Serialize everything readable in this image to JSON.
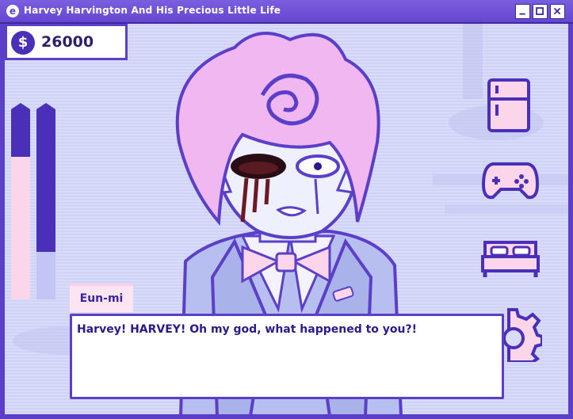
{
  "window": {
    "title": "Harvey Harvington And His Precious Little Life",
    "app_icon_glyph": "e"
  },
  "hud": {
    "money_icon": "dollar-coin-icon",
    "money_glyph": "$",
    "money_value": "26000",
    "meters": [
      {
        "name": "health-meter",
        "level": 0.75
      },
      {
        "name": "energy-meter",
        "level": 0.25
      }
    ]
  },
  "menu": {
    "items": [
      {
        "name": "fridge-button",
        "icon": "fridge-icon"
      },
      {
        "name": "games-button",
        "icon": "gamepad-icon"
      },
      {
        "name": "bed-button",
        "icon": "bed-icon"
      },
      {
        "name": "settings-button",
        "icon": "gear-icon"
      }
    ]
  },
  "dialog": {
    "speaker": "Eun-mi",
    "line": "Harvey! HARVEY! Oh my god, what happened to you?!"
  },
  "colors": {
    "frame": "#5b3fc9",
    "ink": "#4a2fb8",
    "pink": "#fbd6ea",
    "lavender": "#c3c6f4"
  }
}
